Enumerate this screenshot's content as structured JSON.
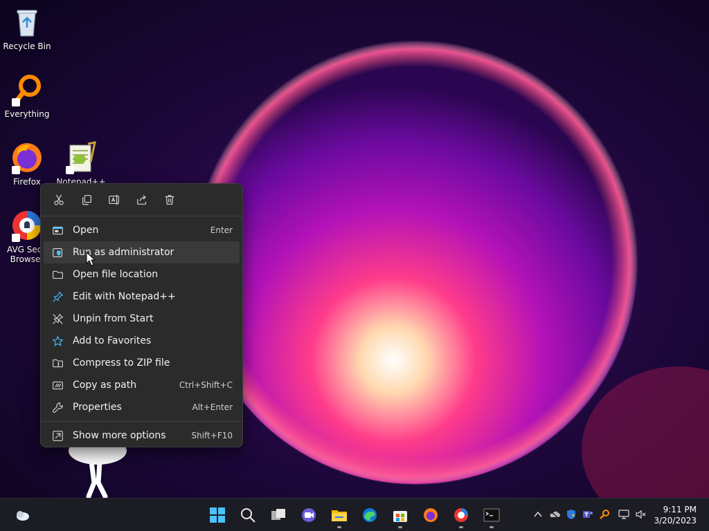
{
  "desktop": {
    "icons": [
      {
        "label": "Recycle Bin",
        "icon": "recycle-bin-icon"
      },
      {
        "label": "Everything",
        "icon": "everything-search-icon"
      },
      {
        "label": "Firefox",
        "icon": "firefox-icon"
      },
      {
        "label": "Notepad++",
        "icon": "notepad-plus-plus-icon"
      },
      {
        "label": "AVG Secu",
        "label2": "Browser",
        "icon": "avg-secure-browser-icon"
      }
    ]
  },
  "context_menu": {
    "quick_actions": [
      {
        "name": "cut",
        "icon": "cut-icon"
      },
      {
        "name": "copy",
        "icon": "copy-icon"
      },
      {
        "name": "rename",
        "icon": "rename-icon"
      },
      {
        "name": "share",
        "icon": "share-icon"
      },
      {
        "name": "delete",
        "icon": "trash-icon"
      }
    ],
    "items": [
      {
        "label": "Open",
        "shortcut": "Enter",
        "icon": "open-app-icon"
      },
      {
        "label": "Run as administrator",
        "shortcut": "",
        "icon": "shield-admin-icon",
        "hover": true
      },
      {
        "label": "Open file location",
        "shortcut": "",
        "icon": "folder-icon"
      },
      {
        "label": "Edit with Notepad++",
        "shortcut": "",
        "icon": "notepad-edit-icon"
      },
      {
        "label": "Unpin from Start",
        "shortcut": "",
        "icon": "unpin-icon"
      },
      {
        "label": "Add to Favorites",
        "shortcut": "",
        "icon": "star-icon"
      },
      {
        "label": "Compress to ZIP file",
        "shortcut": "",
        "icon": "zip-icon"
      },
      {
        "label": "Copy as path",
        "shortcut": "Ctrl+Shift+C",
        "icon": "copy-path-icon"
      },
      {
        "label": "Properties",
        "shortcut": "Alt+Enter",
        "icon": "wrench-icon"
      }
    ],
    "footer": {
      "label": "Show more options",
      "shortcut": "Shift+F10",
      "icon": "more-options-icon"
    }
  },
  "taskbar": {
    "apps": [
      "start-icon",
      "search-icon",
      "task-view-icon",
      "chat-icon",
      "file-explorer-icon",
      "edge-icon",
      "store-icon",
      "firefox-icon",
      "avg-browser-icon",
      "terminal-icon"
    ],
    "tray": [
      "chevron-up-icon",
      "onedrive-icon",
      "defender-icon",
      "teams-icon",
      "everything-tray-icon",
      "network-icon",
      "volume-muted-icon"
    ]
  },
  "clock": {
    "time": "9:11 PM",
    "date": "3/20/2023"
  },
  "colors": {
    "menu_bg": "#2b2b2b",
    "accent": "#4cc2ff",
    "taskbar_bg": "#1c1c24"
  }
}
